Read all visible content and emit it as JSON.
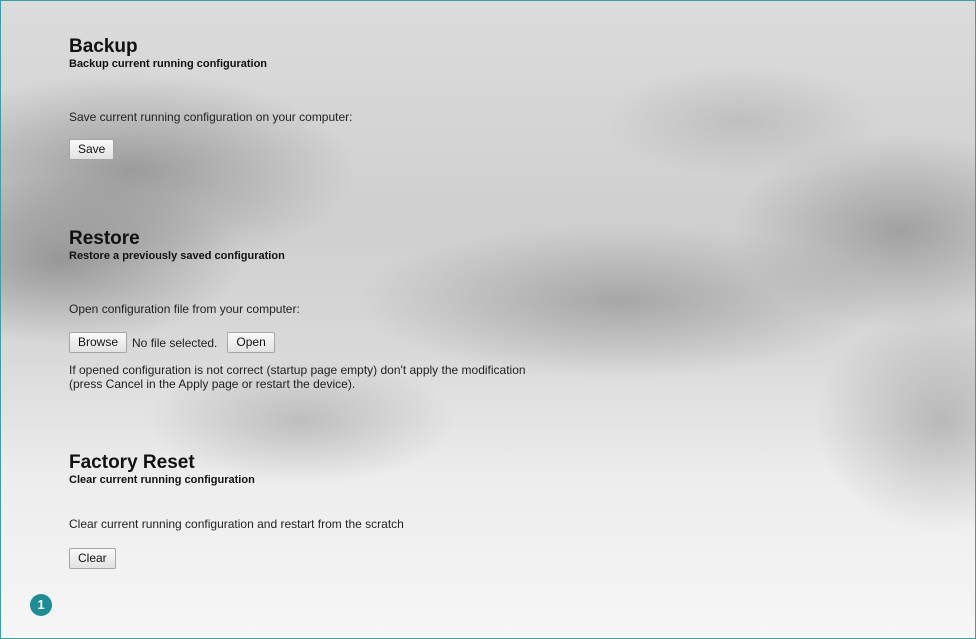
{
  "backup": {
    "title": "Backup",
    "subtitle": "Backup current running configuration",
    "description": "Save current running configuration on your computer:",
    "save_label": "Save"
  },
  "restore": {
    "title": "Restore",
    "subtitle": "Restore a previously saved configuration",
    "description": "Open configuration file from your computer:",
    "browse_label": "Browse",
    "file_status": "No file selected.",
    "open_label": "Open",
    "note_line1": "If opened configuration is not correct (startup page empty) don't apply the modification",
    "note_line2": "(press Cancel in the Apply page or restart the device)."
  },
  "factory_reset": {
    "title": "Factory Reset",
    "subtitle": "Clear current running configuration",
    "description": "Clear current running configuration and restart from the scratch",
    "clear_label": "Clear"
  },
  "callout": {
    "number": "1",
    "color": "#1d8c96"
  },
  "colors": {
    "frame_border": "#3aa0a8"
  }
}
